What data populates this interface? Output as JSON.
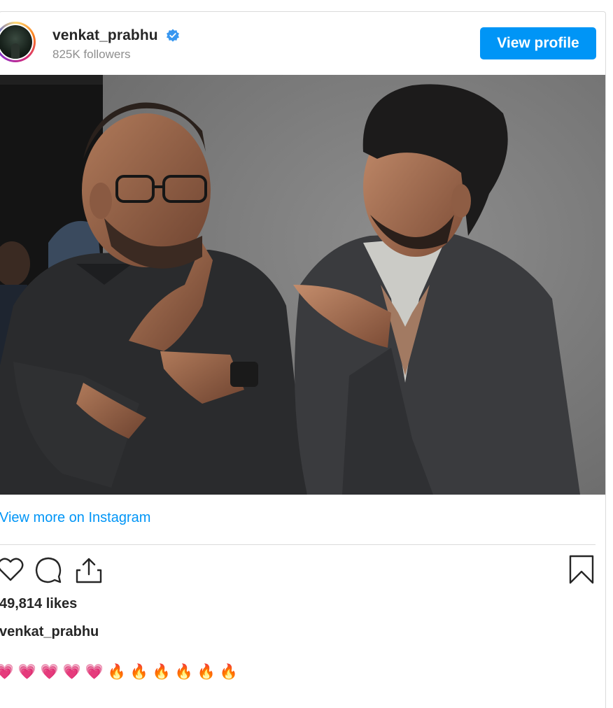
{
  "post": {
    "username": "venkat_prabhu",
    "followers": "825K followers",
    "view_profile_label": "View profile",
    "view_more_label": "View more on Instagram",
    "likes": "49,814 likes",
    "caption_user": "venkat_prabhu",
    "caption_emojis": [
      "💗",
      "💗",
      "💗",
      "💗",
      "💗",
      "🔥",
      "🔥",
      "🔥",
      "🔥",
      "🔥",
      "🔥"
    ],
    "brand_color": "#0095f6",
    "icons": {
      "verified": "verified-badge-icon",
      "like": "heart-icon",
      "comment": "comment-icon",
      "share": "share-icon",
      "save": "bookmark-icon"
    }
  }
}
